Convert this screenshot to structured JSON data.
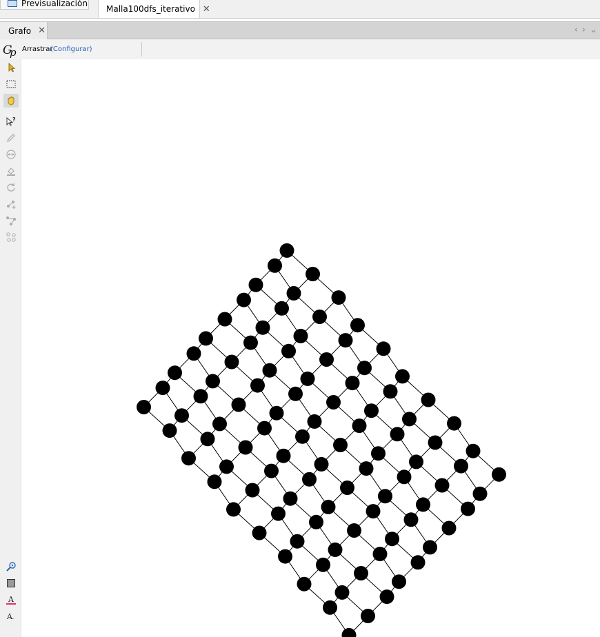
{
  "tabs": {
    "preview_label": "Previsualización",
    "graph_label": "Malla100dfs_iterativo"
  },
  "panel": {
    "tab_label": "Grafo"
  },
  "toolbar": {
    "mode_label": "Arrastrar",
    "configure_label": "(Configurar)"
  },
  "left_tools": [
    {
      "icon": "pointer-icon",
      "active": false
    },
    {
      "icon": "rectangle-select-icon",
      "active": false
    },
    {
      "icon": "hand-drag-icon",
      "active": true
    },
    {
      "icon": "edit-info-icon",
      "active": false
    },
    {
      "icon": "pencil-icon",
      "active": false
    },
    {
      "icon": "resize-icon",
      "active": false
    },
    {
      "icon": "paint-bucket-icon",
      "active": false
    },
    {
      "icon": "refresh-icon",
      "active": false
    },
    {
      "icon": "add-node-icon",
      "active": false
    },
    {
      "icon": "add-edge-icon",
      "active": false
    },
    {
      "icon": "shortest-path-icon",
      "active": false
    },
    {
      "icon": "zoom-center-icon",
      "active": false
    },
    {
      "icon": "background-color-icon",
      "active": false
    },
    {
      "icon": "font-color-icon",
      "active": false
    },
    {
      "icon": "font-size-icon",
      "active": false
    }
  ],
  "colors": {
    "node": "#000000",
    "edge": "#000000",
    "link": "#1f62b4"
  }
}
